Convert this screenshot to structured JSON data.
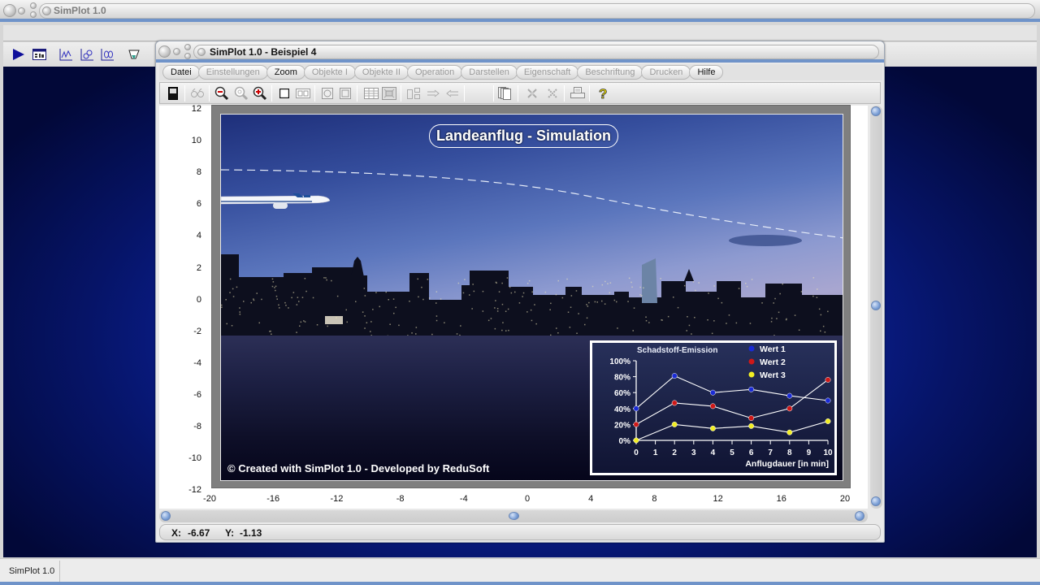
{
  "outer_window": {
    "title": "SimPlot 1.0",
    "toolbar_icons": [
      "play-icon",
      "data-table-icon",
      "line-chart-icon",
      "parametric-chart-icon",
      "polar-chart-icon",
      "fill-icon"
    ]
  },
  "taskbar": {
    "items": [
      {
        "label": "SimPlot 1.0"
      }
    ]
  },
  "window": {
    "title": "SimPlot 1.0 - Beispiel 4",
    "menu": [
      {
        "label": "Datei",
        "enabled": true
      },
      {
        "label": "Einstellungen",
        "enabled": false
      },
      {
        "label": "Zoom",
        "enabled": true
      },
      {
        "label": "Objekte I",
        "enabled": false
      },
      {
        "label": "Objekte II",
        "enabled": false
      },
      {
        "label": "Operation",
        "enabled": false
      },
      {
        "label": "Darstellen",
        "enabled": false
      },
      {
        "label": "Eigenschaft",
        "enabled": false
      },
      {
        "label": "Beschriftung",
        "enabled": false
      },
      {
        "label": "Drucken",
        "enabled": false
      },
      {
        "label": "Hilfe",
        "enabled": true
      }
    ],
    "toolbar_icons": [
      "device-icon",
      "glasses-icon",
      "zoom-out-icon",
      "zoom-reset-icon",
      "zoom-in-icon",
      "square-icon",
      "double-frame-icon",
      "circle-frame-icon",
      "disk-frame-icon",
      "table-icon",
      "image-icon",
      "copy-arrange-icon",
      "arrow-right-icon",
      "arrow-left-icon",
      "pages-icon",
      "cross-icon",
      "cross-dashed-icon",
      "printer-icon",
      "help-icon"
    ],
    "status": {
      "x_label": "X:",
      "x_value": "-6.67",
      "y_label": "Y:",
      "y_value": "-1.13"
    }
  },
  "plot": {
    "y_ticks": [
      "12",
      "10",
      "8",
      "6",
      "4",
      "2",
      "0",
      "-2",
      "-4",
      "-6",
      "-8",
      "-10",
      "-12"
    ],
    "x_ticks": [
      "-20",
      "-16",
      "-12",
      "-8",
      "-4",
      "0",
      "4",
      "8",
      "12",
      "16",
      "20"
    ],
    "title": "Landeanflug - Simulation",
    "copyright": "© Created with SimPlot 1.0 - Developed by ReduSoft"
  },
  "chart_data": {
    "type": "line",
    "title": "Schadstoff-Emission",
    "xlabel": "Anflugdauer [in  min]",
    "ylabel": "",
    "x_ticks": [
      "0",
      "1",
      "2",
      "3",
      "4",
      "5",
      "6",
      "7",
      "8",
      "9",
      "10"
    ],
    "y_ticks": [
      "0%",
      "20%",
      "40%",
      "60%",
      "80%",
      "100%"
    ],
    "xlim": [
      0,
      10
    ],
    "ylim": [
      0,
      100
    ],
    "legend_position": "top-right",
    "series": [
      {
        "name": "Wert 1",
        "color": "#1a2bd6",
        "x": [
          0,
          2,
          4,
          6,
          8,
          10
        ],
        "values": [
          40,
          81,
          60,
          64,
          56,
          50
        ]
      },
      {
        "name": "Wert 2",
        "color": "#d01818",
        "x": [
          0,
          2,
          4,
          6,
          8,
          10
        ],
        "values": [
          20,
          47,
          43,
          28,
          40,
          76
        ]
      },
      {
        "name": "Wert 3",
        "color": "#f2ee24",
        "x": [
          0,
          2,
          4,
          6,
          8,
          10
        ],
        "values": [
          0,
          20,
          15,
          18,
          10,
          24
        ]
      }
    ]
  }
}
